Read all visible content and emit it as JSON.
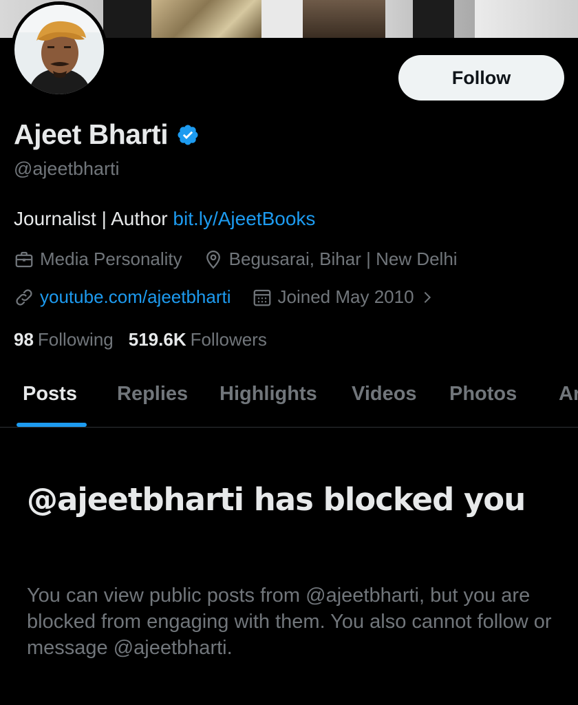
{
  "profile": {
    "display_name": "Ajeet Bharti",
    "handle": "@ajeetbharti",
    "bio_text": "Journalist | Author ",
    "bio_link": "bit.ly/AjeetBooks",
    "category": "Media Personality",
    "location": "Begusarai, Bihar | New Delhi",
    "website": "youtube.com/ajeetbharti",
    "joined": "Joined May 2010",
    "verified": true
  },
  "actions": {
    "follow_label": "Follow"
  },
  "stats": {
    "following_count": "98",
    "following_label": "Following",
    "followers_count": "519.6K",
    "followers_label": "Followers"
  },
  "tabs": [
    {
      "label": "Posts",
      "active": true
    },
    {
      "label": "Replies",
      "active": false
    },
    {
      "label": "Highlights",
      "active": false
    },
    {
      "label": "Videos",
      "active": false
    },
    {
      "label": "Photos",
      "active": false
    },
    {
      "label": "Ar",
      "active": false
    }
  ],
  "blocked": {
    "title": "@ajeetbharti has blocked you",
    "description": "You can view public posts from @ajeetbharti, but you are blocked from engaging with them. You also cannot follow or message @ajeetbharti."
  },
  "colors": {
    "background": "#000000",
    "primary_text": "#e7e9ea",
    "secondary_text": "#71767b",
    "accent": "#1d9bf0",
    "follow_button_bg": "#eff3f4"
  }
}
